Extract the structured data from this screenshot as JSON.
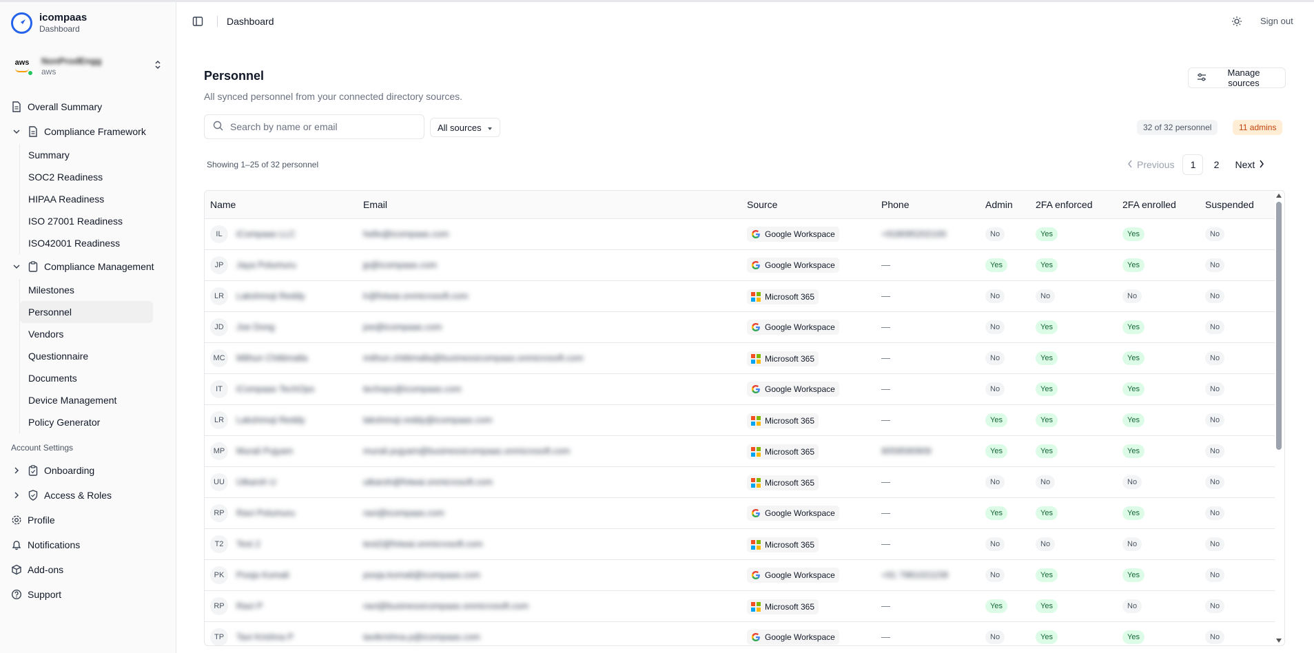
{
  "brand": {
    "title": "icompaas",
    "subtitle": "Dashboard"
  },
  "account": {
    "name": "NonProdEngg",
    "provider": "aws",
    "logo_text": "aws"
  },
  "nav": {
    "overall_summary": "Overall Summary",
    "compliance_framework": {
      "label": "Compliance Framework",
      "items": [
        "Summary",
        "SOC2 Readiness",
        "HIPAA Readiness",
        "ISO 27001 Readiness",
        "ISO42001 Readiness"
      ]
    },
    "compliance_management": {
      "label": "Compliance Management",
      "items": [
        "Milestones",
        "Personnel",
        "Vendors",
        "Questionnaire",
        "Documents",
        "Device Management",
        "Policy Generator"
      ]
    },
    "account_settings_label": "Account Settings",
    "onboarding": "Onboarding",
    "access_roles": "Access & Roles",
    "profile": "Profile",
    "notifications": "Notifications",
    "addons": "Add-ons",
    "support": "Support"
  },
  "header": {
    "title": "Dashboard",
    "signout": "Sign out"
  },
  "page": {
    "title": "Personnel",
    "description": "All synced personnel from your connected directory sources.",
    "manage_sources": "Manage sources",
    "search_placeholder": "Search by name or email",
    "source_filter": "All sources",
    "count_badge": "32 of 32 personnel",
    "admins_badge": "11 admins",
    "showing": "Showing 1–25 of 32 personnel",
    "pager": {
      "previous": "Previous",
      "page1": "1",
      "page2": "2",
      "next": "Next"
    }
  },
  "colors": {
    "accent": "#2563eb",
    "yes_bg": "#dcfce7",
    "yes_fg": "#166534",
    "admins_bg": "#ffedd5",
    "admins_fg": "#c2410c"
  },
  "table": {
    "columns": [
      "Name",
      "Email",
      "Source",
      "Phone",
      "Admin",
      "2FA enforced",
      "2FA enrolled",
      "Suspended"
    ],
    "rows": [
      {
        "initials": "IL",
        "name": "iCompaas LLC",
        "email": "hello@icompaas.com",
        "source": "Google Workspace",
        "phone": "+918095202100",
        "admin": "No",
        "fa_enforced": "Yes",
        "fa_enrolled": "Yes",
        "suspended": "No"
      },
      {
        "initials": "JP",
        "name": "Jaya Polumuru",
        "email": "jp@icompaas.com",
        "source": "Google Workspace",
        "phone": "—",
        "admin": "Yes",
        "fa_enforced": "Yes",
        "fa_enrolled": "Yes",
        "suspended": "No"
      },
      {
        "initials": "LR",
        "name": "Lakshmoji Reddy",
        "email": "lr@fvtwai.onmicrosoft.com",
        "source": "Microsoft 365",
        "phone": "—",
        "admin": "No",
        "fa_enforced": "No",
        "fa_enrolled": "No",
        "suspended": "No"
      },
      {
        "initials": "JD",
        "name": "Joe Dong",
        "email": "joe@icompaas.com",
        "source": "Google Workspace",
        "phone": "—",
        "admin": "No",
        "fa_enforced": "Yes",
        "fa_enrolled": "Yes",
        "suspended": "No"
      },
      {
        "initials": "MC",
        "name": "Mithun Chittimalla",
        "email": "mithun.chittimalla@businessicompaas.onmicrosoft.com",
        "source": "Microsoft 365",
        "phone": "—",
        "admin": "No",
        "fa_enforced": "Yes",
        "fa_enrolled": "Yes",
        "suspended": "No"
      },
      {
        "initials": "IT",
        "name": "iCompaas TechOps",
        "email": "techops@icompaas.com",
        "source": "Google Workspace",
        "phone": "—",
        "admin": "No",
        "fa_enforced": "Yes",
        "fa_enrolled": "Yes",
        "suspended": "No"
      },
      {
        "initials": "LR",
        "name": "Lakshmoji Reddy",
        "email": "lakshmoji.reddy@icompaas.com",
        "source": "Microsoft 365",
        "phone": "—",
        "admin": "Yes",
        "fa_enforced": "Yes",
        "fa_enrolled": "Yes",
        "suspended": "No"
      },
      {
        "initials": "MP",
        "name": "Murali Pujyam",
        "email": "murali.pujyam@businessicompaas.onmicrosoft.com",
        "source": "Microsoft 365",
        "phone": "9059590909",
        "admin": "Yes",
        "fa_enforced": "Yes",
        "fa_enrolled": "Yes",
        "suspended": "No"
      },
      {
        "initials": "UU",
        "name": "Utkarsh U",
        "email": "utkarsh@fvtwai.onmicrosoft.com",
        "source": "Microsoft 365",
        "phone": "—",
        "admin": "No",
        "fa_enforced": "No",
        "fa_enrolled": "No",
        "suspended": "No"
      },
      {
        "initials": "RP",
        "name": "Ravi Polumuru",
        "email": "ravi@icompaas.com",
        "source": "Google Workspace",
        "phone": "—",
        "admin": "Yes",
        "fa_enforced": "Yes",
        "fa_enrolled": "Yes",
        "suspended": "No"
      },
      {
        "initials": "T2",
        "name": "Test 2",
        "email": "test2@fvtwai.onmicrosoft.com",
        "source": "Microsoft 365",
        "phone": "—",
        "admin": "No",
        "fa_enforced": "No",
        "fa_enrolled": "No",
        "suspended": "No"
      },
      {
        "initials": "PK",
        "name": "Pooja Komali",
        "email": "pooja.komali@icompaas.com",
        "source": "Google Workspace",
        "phone": "+91 7981021158",
        "admin": "No",
        "fa_enforced": "Yes",
        "fa_enrolled": "Yes",
        "suspended": "No"
      },
      {
        "initials": "RP",
        "name": "Ravi P",
        "email": "ravi@businessicompaas.onmicrosoft.com",
        "source": "Microsoft 365",
        "phone": "—",
        "admin": "Yes",
        "fa_enforced": "Yes",
        "fa_enrolled": "No",
        "suspended": "No"
      },
      {
        "initials": "TP",
        "name": "Tavi Krishna P",
        "email": "tavikrishna.p@icompaas.com",
        "source": "Google Workspace",
        "phone": "—",
        "admin": "No",
        "fa_enforced": "Yes",
        "fa_enrolled": "Yes",
        "suspended": "No"
      }
    ]
  }
}
